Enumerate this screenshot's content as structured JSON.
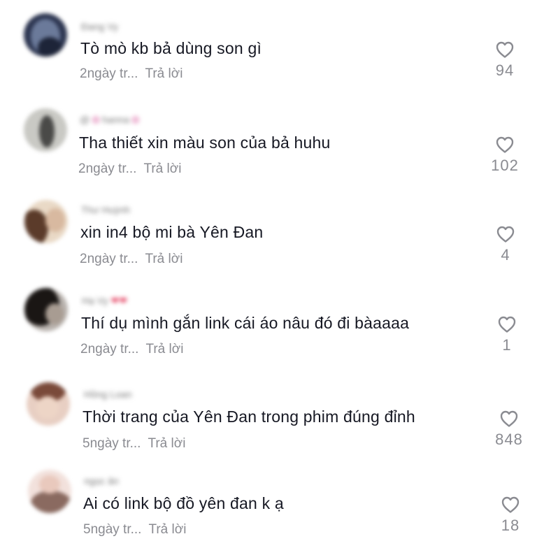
{
  "comments": [
    {
      "username": "Đang Vy",
      "text": "Tò mò kb bả dùng son gì",
      "time": "2ngày tr...",
      "reply": "Trả lời",
      "likes": "94",
      "avatar_colors": [
        "#2c3550",
        "#6b7a9a"
      ]
    },
    {
      "username": "hanna",
      "text": "Tha thiết xin màu son của bả huhu",
      "time": "2ngày tr...",
      "reply": "Trả lời",
      "likes": "102",
      "avatar_colors": [
        "#c9c9c4",
        "#4a4a48"
      ]
    },
    {
      "username": "Thư Huỳnh",
      "text": "xin in4 bộ mi bà Yên Đan",
      "time": "2ngày tr...",
      "reply": "Trả lời",
      "likes": "4",
      "avatar_colors": [
        "#e9d9c6",
        "#5b3b2a"
      ]
    },
    {
      "username": "Hạ Vy",
      "text": "Thí dụ mình gắn link cái áo nâu đó đi bàaaaa",
      "time": "2ngày tr...",
      "reply": "Trả lời",
      "likes": "1",
      "avatar_colors": [
        "#b8b2ad",
        "#1a1614"
      ]
    },
    {
      "username": "Hồng Loan",
      "text": "Thời trang của Yên Đan trong phim đúng đỉnh",
      "time": "5ngày tr...",
      "reply": "Trả lời",
      "likes": "848",
      "avatar_colors": [
        "#e8cfc3",
        "#7a4a3a"
      ]
    },
    {
      "username": "ngọc ân",
      "text": "Ai có link bộ đồ yên đan k ạ",
      "time": "5ngày tr...",
      "reply": "Trả lời",
      "likes": "18",
      "avatar_colors": [
        "#f2e1dc",
        "#8a6a60"
      ]
    }
  ],
  "icons": {
    "like": "heart-outline-icon"
  },
  "colors": {
    "text": "#161823",
    "secondary": "#8a8b91",
    "background": "#ffffff"
  }
}
